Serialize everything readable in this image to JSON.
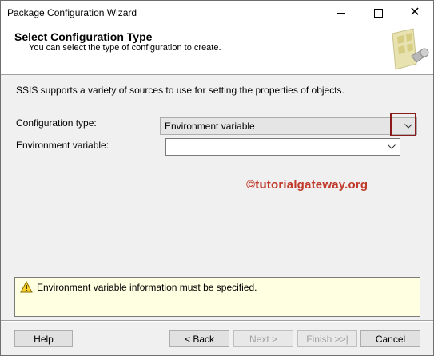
{
  "window": {
    "title": "Package Configuration Wizard"
  },
  "header": {
    "title": "Select Configuration Type",
    "subtitle": "You can select the type of configuration to create."
  },
  "intro_text": "SSIS supports a variety of sources to use for setting the properties of objects.",
  "form": {
    "config_type_label": "Configuration type:",
    "config_type_value": "Environment variable",
    "env_variable_label": "Environment variable:",
    "env_variable_value": ""
  },
  "watermark": "©tutorialgateway.org",
  "info": {
    "icon": "warning-icon",
    "message": "Environment variable information must be specified."
  },
  "buttons": {
    "help": "Help",
    "back": "< Back",
    "next": "Next >",
    "finish": "Finish >>|",
    "cancel": "Cancel"
  },
  "colors": {
    "highlight": "#8b1a1a",
    "watermark": "#c0392b",
    "info_background": "#ffffe1"
  }
}
